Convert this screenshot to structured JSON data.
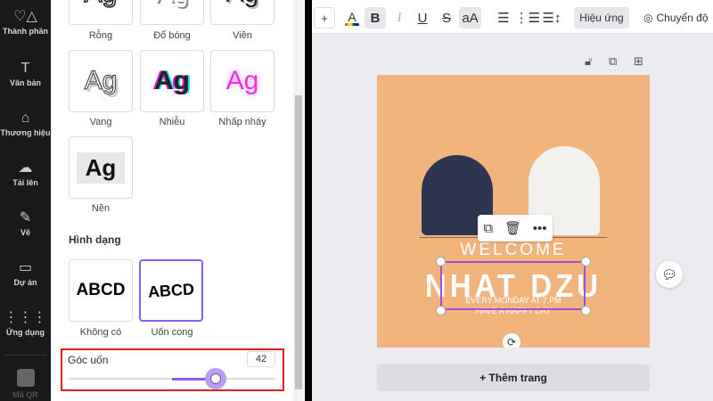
{
  "sidebar": {
    "items": [
      {
        "label": "Thành phần",
        "icon": "shapes-icon"
      },
      {
        "label": "Văn bản",
        "icon": "text-icon"
      },
      {
        "label": "Thương hiệu",
        "icon": "brand-icon"
      },
      {
        "label": "Tải lên",
        "icon": "upload-icon"
      },
      {
        "label": "Vẽ",
        "icon": "draw-icon"
      },
      {
        "label": "Dự án",
        "icon": "folder-icon"
      },
      {
        "label": "Ứng dụng",
        "icon": "apps-icon"
      },
      {
        "label": "Mã QR",
        "icon": "qr-icon"
      }
    ]
  },
  "panel": {
    "effects": [
      {
        "label": "Rỗng",
        "sample": "Ag"
      },
      {
        "label": "Đổ bóng",
        "sample": "Ag"
      },
      {
        "label": "Viền",
        "sample": "Ag"
      },
      {
        "label": "Vang",
        "sample": "Ag"
      },
      {
        "label": "Nhiễu",
        "sample": "Ag"
      },
      {
        "label": "Nhấp nháy",
        "sample": "Ag"
      },
      {
        "label": "Nền",
        "sample": "Ag"
      }
    ],
    "shape_heading": "Hình dạng",
    "shapes": [
      {
        "label": "Không có",
        "sample": "ABCD"
      },
      {
        "label": "Uốn cong",
        "sample": "ABCD",
        "selected": true
      }
    ],
    "curve": {
      "label": "Góc uốn",
      "value": "42",
      "value_num": 42,
      "min": -100,
      "max": 100
    },
    "accent": "#8b3dff",
    "highlight": "#e0201f"
  },
  "toolbar": {
    "plus": "+",
    "color_letter": "A",
    "bold": "B",
    "italic": "I",
    "underline": "U",
    "strike": "S",
    "case": "aA",
    "effects": "Hiệu ứng",
    "animate": "Chuyển độ"
  },
  "canvas": {
    "bg": "#f1b47d",
    "welcome": "WELCOME",
    "name": "NHAT DZU",
    "line1": "EVERY MONDAY AT 7.PM",
    "line2": "HAVE A HAPPY DAY",
    "add_page": "+ Thêm trang"
  }
}
